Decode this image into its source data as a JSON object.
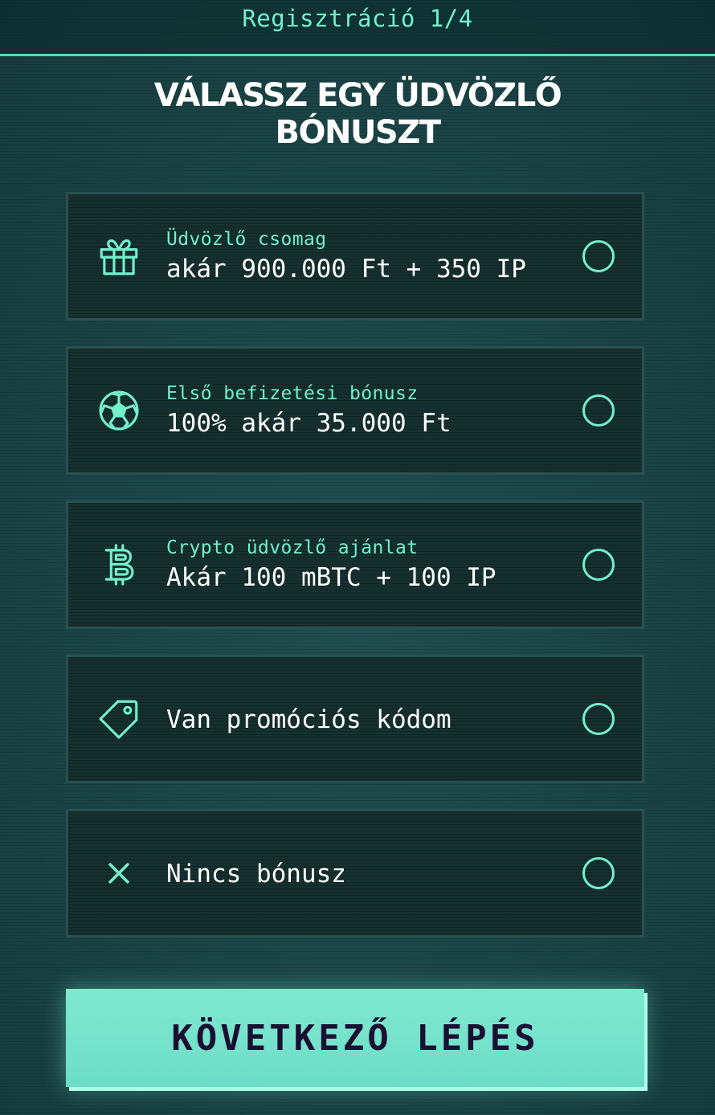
{
  "header": {
    "step_label": "Regisztráció 1/4"
  },
  "title": {
    "line1": "VÁLASSZ EGY ÜDVÖZLŐ",
    "line2": "BÓNUSZT"
  },
  "options": [
    {
      "icon": "gift-icon",
      "subtitle": "Üdvözlő csomag",
      "main": "akár 900.000 Ft + 350 IP",
      "selected": false
    },
    {
      "icon": "soccer-ball-icon",
      "subtitle": "Első befizetési bónusz",
      "main": "100% akár 35.000 Ft",
      "selected": false
    },
    {
      "icon": "bitcoin-icon",
      "subtitle": "Crypto üdvözlő ajánlat",
      "main": "Akár 100 mBTC + 100 IP",
      "selected": false
    },
    {
      "icon": "tag-icon",
      "main": "Van promóciós kódom",
      "selected": false
    },
    {
      "icon": "close-icon",
      "main": "Nincs bónusz",
      "selected": false
    }
  ],
  "next_button": {
    "label": "KÖVETKEZŐ LÉPÉS"
  },
  "colors": {
    "accent": "#72f0cc",
    "background": "#1d4a4b",
    "card": "#15302f",
    "button": "#7fe9cf",
    "button_text": "#1b0f33"
  }
}
